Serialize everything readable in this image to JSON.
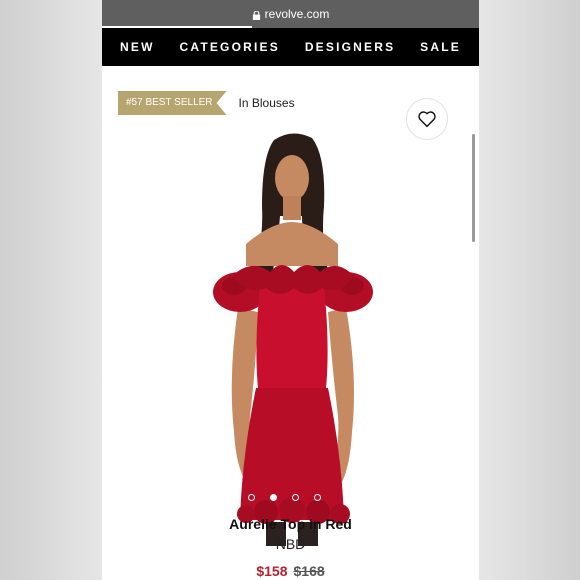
{
  "browser": {
    "url": "revolve.com"
  },
  "nav": {
    "items": [
      "NEW",
      "CATEGORIES",
      "DESIGNERS",
      "SALE"
    ]
  },
  "badge": {
    "rank": "#57 BEST SELLER",
    "category": "In Blouses"
  },
  "carousel": {
    "count": 4,
    "active": 1
  },
  "product": {
    "name": "Aurelie Top in Red",
    "brand": "NBD",
    "price": "$158",
    "original_price": "$168"
  },
  "colors": {
    "badge": "#b7a56f",
    "price": "#b5222e",
    "dress": "#c8102e"
  },
  "icons": [
    "lock-icon",
    "heart-icon"
  ]
}
